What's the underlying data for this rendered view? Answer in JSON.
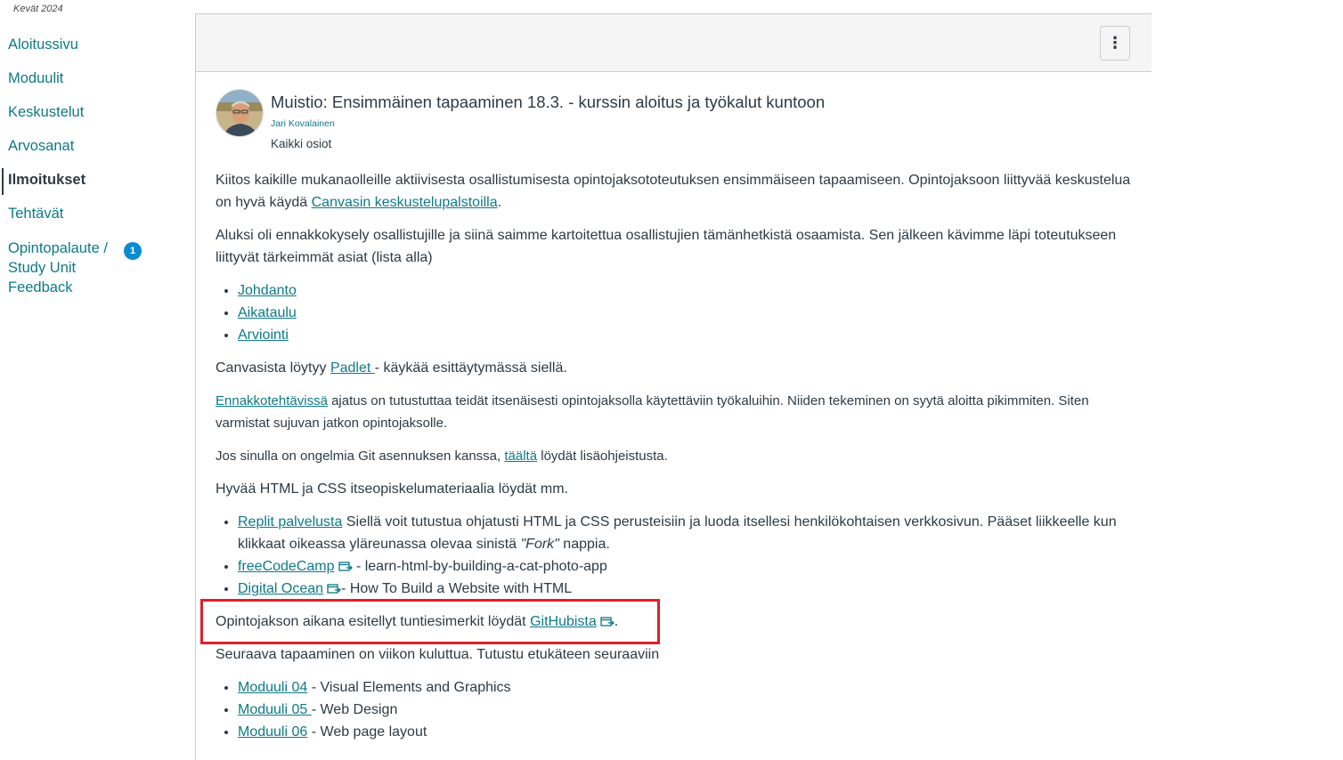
{
  "nav": {
    "term": "Kevät 2024",
    "items": [
      {
        "label": "Aloitussivu"
      },
      {
        "label": "Moduulit"
      },
      {
        "label": "Keskustelut"
      },
      {
        "label": "Arvosanat"
      },
      {
        "label": "Ilmoitukset"
      },
      {
        "label": "Tehtävät"
      },
      {
        "label_lines": [
          "Opintopalaute /",
          "Study Unit",
          "Feedback"
        ],
        "badge": "1"
      }
    ],
    "active": "Ilmoitukset"
  },
  "toolbar": {
    "options_glyph": "⋮"
  },
  "announcement": {
    "title": "Muistio: Ensimmäinen tapaaminen 18.3. - kurssin aloitus ja työkalut kuntoon",
    "author": "Jari Kovalainen",
    "sections": "Kaikki osiot"
  },
  "body": {
    "p1_text": "Kiitos kaikille mukanaolleille aktiivisesta osallistumisesta opintojaksototeutuksen ensimmäiseen tapaamiseen. Opintojaksoon liittyvää keskustelua on hyvä käydä ",
    "p1_link": "Canvasin keskustelupalstoilla",
    "p1_end": ".",
    "p2_text": "Aluksi oli ennakkokysely osallistujille ja siinä saimme kartoitettua osallistujien tämänhetkistä osaamista. Sen jälkeen kävimme läpi toteutukseen liittyvät tärkeimmät asiat (lista alla)",
    "list1": [
      "Johdanto",
      "Aikataulu",
      "Arviointi"
    ],
    "p3_text": "Canvasista löytyy ",
    "p3_link": "Padlet ",
    "p3_end": "- käykää esittäytymässä siellä.",
    "p4_link": "Ennakkotehtävissä",
    "p4_text": " ajatus on tutustuttaa teidät itsenäisesti opintojaksolla käytettäviin työkaluihin. Niiden tekeminen on syytä aloitta pikimmiten. Siten varmistat sujuvan jatkon opintojaksolle.",
    "p5_text": "Jos sinulla on ongelmia Git asennuksen kanssa, ",
    "p5_link": "täältä",
    "p5_end": " löydät lisäohjeistusta.",
    "p6_text": "Hyvää HTML ja CSS itseopiskelumateriaalia löydät mm.",
    "res1_link": "Replit palvelusta",
    "res1_text_a": " Siellä voit tutustua ohjatusti HTML ja CSS perusteisiin ja luoda itsellesi henkilökohtaisen verkkosivun. Pääset liikkeelle kun klikkaat oikeassa yläreunassa olevaa sinistä ",
    "res1_em": "\"Fork\"",
    "res1_text_b": " nappia.",
    "res2_link": "freeCodeCamp",
    "res2_text": " - learn-html-by-building-a-cat-photo-app",
    "res3_link": "Digital Ocean",
    "res3_text": "- How To Build a Website with HTML",
    "p7_text": "Opintojakson aikana esitellyt tuntiesimerkit löydät ",
    "p7_link": "GitHubista",
    "p7_end": ".",
    "p8_text": "Seuraava tapaaminen on viikon kuluttua. Tutustu etukäteen seuraaviin",
    "mod1_link": "Moduuli 04",
    "mod1_text": " - Visual Elements and Graphics",
    "mod2_link": "Moduuli 05 ",
    "mod2_text": "- Web Design",
    "mod3_link": "Moduuli 06",
    "mod3_text": " - Web page layout"
  },
  "colors": {
    "link": "#0e7a86",
    "text": "#2d3b45",
    "badge": "#0b8bd1",
    "highlight": "#e0202a"
  }
}
